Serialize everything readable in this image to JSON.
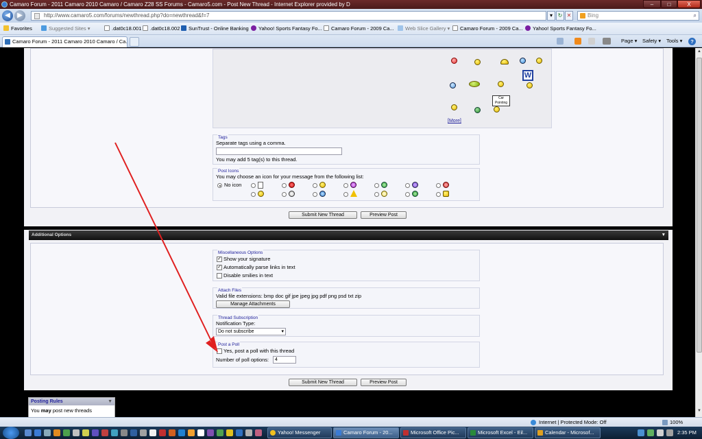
{
  "window": {
    "title": "Camaro Forum - 2011 Camaro 2010 Camaro / Camaro Z28 SS Forums - Camaro5.com - Post New Thread - Internet Explorer provided by D",
    "minimize": "–",
    "maximize": "□",
    "close": "X"
  },
  "address_bar": {
    "url": "http://www.camaro5.com/forums/newthread.php?do=newthread&f=7",
    "search_placeholder": "Bing"
  },
  "favorites": {
    "label": "Favorites",
    "items": [
      "Suggested Sites ▾",
      ".dat0c18.001",
      ".dat0c18.002",
      "SunTrust - Online Banking",
      "Yahoo! Sports Fantasy Fo...",
      "Camaro Forum - 2009 Ca...",
      "Web Slice Gallery ▾",
      "Camaro Forum - 2009 Ca...",
      "Yahoo! Sports Fantasy Fo..."
    ]
  },
  "tab": {
    "title": "Camaro Forum - 2011 Camaro 2010 Camaro / Ca..."
  },
  "command_bar": {
    "page": "Page ▾",
    "safety": "Safety ▾",
    "tools": "Tools ▾",
    "help": "?"
  },
  "smilies": {
    "more_link": "[More]",
    "sign_text": "Car Pointing"
  },
  "tags": {
    "legend": "Tags",
    "instruction": "Separate tags using a comma.",
    "input_value": "",
    "note": "You may add 5 tag(s) to this thread."
  },
  "post_icons": {
    "legend": "Post Icons",
    "instruction": "You may choose an icon for your message from the following list:",
    "no_icon_label": "No icon",
    "selected": "No icon"
  },
  "buttons": {
    "submit": "Submit New Thread",
    "preview": "Preview Post"
  },
  "additional_options": {
    "header": "Additional Options",
    "collapse_icon": "▼"
  },
  "misc_options": {
    "legend": "Miscellaneous Options",
    "items": [
      {
        "label": "Show your signature",
        "checked": "✓"
      },
      {
        "label": "Automatically parse links in text",
        "checked": "✓"
      },
      {
        "label": "Disable smilies in text",
        "checked": ""
      }
    ]
  },
  "attach_files": {
    "legend": "Attach Files",
    "extensions": "Valid file extensions: bmp doc gif jpe jpeg jpg pdf png psd txt zip",
    "manage_button": "Manage Attachments"
  },
  "thread_subscription": {
    "legend": "Thread Subscription",
    "label": "Notification Type:",
    "selected": "Do not subscribe"
  },
  "poll": {
    "legend": "Post a Poll",
    "checkbox_label": "Yes, post a poll with this thread",
    "options_label": "Number of poll options:",
    "options_value": "4"
  },
  "posting_rules": {
    "header": "Posting Rules",
    "line_prefix": "You ",
    "line_bold": "may",
    "line_suffix": " post new threads"
  },
  "status_bar": {
    "zone": "Internet | Protected Mode: Off",
    "zoom": "100%"
  },
  "taskbar": {
    "tasks": [
      "Yahoo! Messenger",
      "Camaro Forum - 20...",
      "Microsoft Office Pic...",
      "Microsoft Excel - Eil...",
      "Calendar - Microsof..."
    ],
    "time": "2:35 PM"
  },
  "colors": {
    "annotation_arrow": "#e02020",
    "legend_text": "#22229c",
    "title_bar": "#5a2020"
  }
}
